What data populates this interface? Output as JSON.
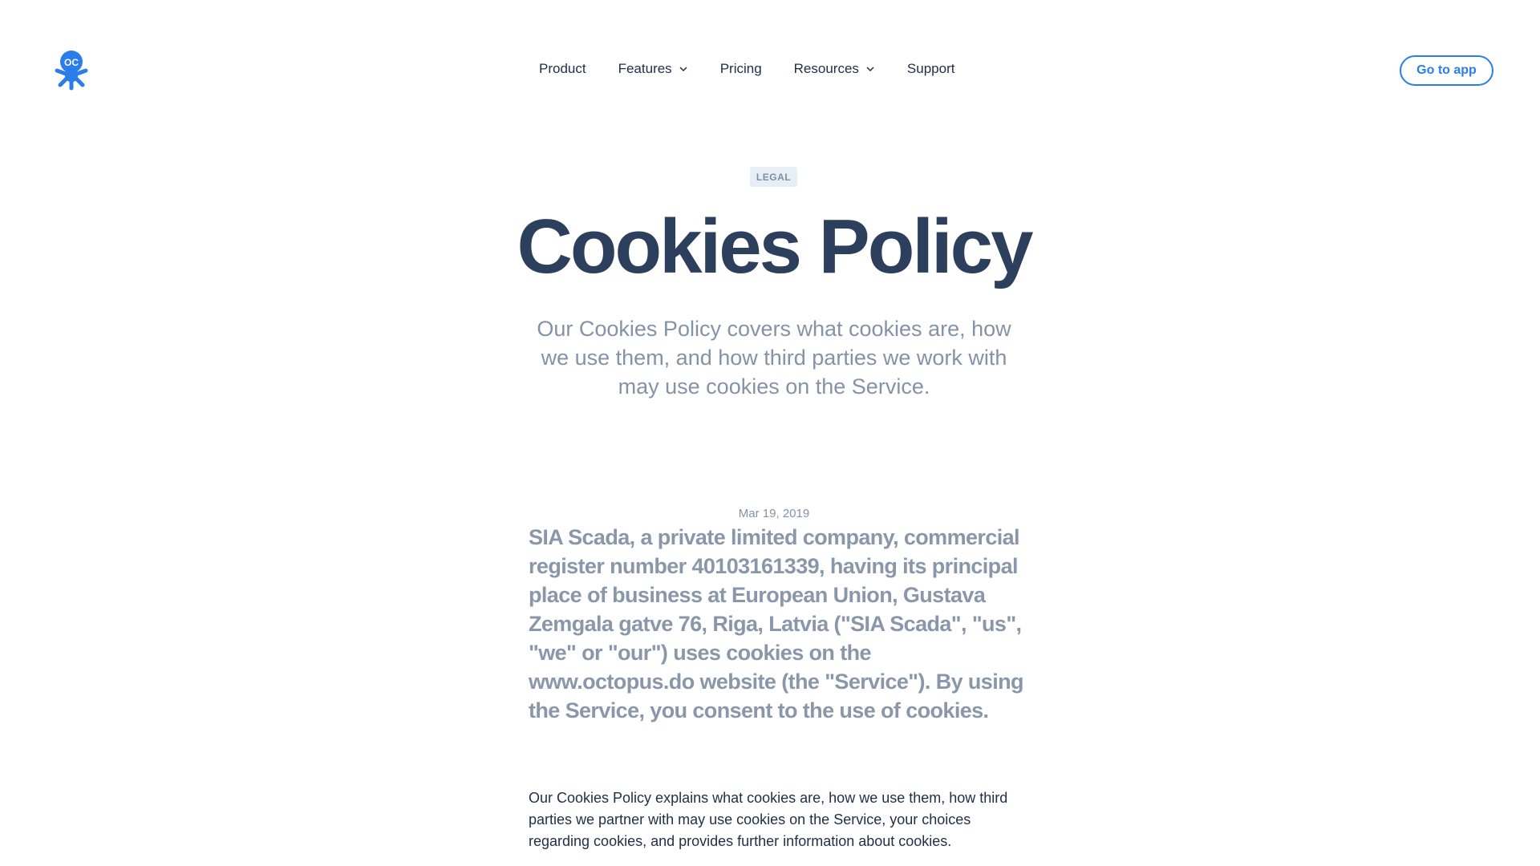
{
  "header": {
    "logo_icon": "octopus-logo-icon",
    "logo_text": "OC",
    "nav": [
      {
        "label": "Product",
        "has_dropdown": false
      },
      {
        "label": "Features",
        "has_dropdown": true
      },
      {
        "label": "Pricing",
        "has_dropdown": false
      },
      {
        "label": "Resources",
        "has_dropdown": true
      },
      {
        "label": "Support",
        "has_dropdown": false
      }
    ],
    "cta_label": "Go to app"
  },
  "hero": {
    "tag": "LEGAL",
    "title": "Cookies Policy",
    "subtitle": "Our Cookies Policy covers what cookies are, how we use them, and how third parties we work with may use cookies on the Service."
  },
  "content": {
    "date": "Mar 19, 2019",
    "lead": "SIA Scada, a private limited company, commercial register number 40103161339, having its principal place of business at European Union, Gustava Zemgala gatve 76, Riga, Latvia (\"SIA Scada\", \"us\", \"we\" or \"our\") uses cookies on the www.octopus.do website (the \"Service\"). By using the Service, you consent to the use of cookies.",
    "paragraph": "Our Cookies Policy explains what cookies are, how we use them, how third parties we partner with may use cookies on the Service, your choices regarding cookies, and provides further information about cookies."
  },
  "colors": {
    "accent": "#2b7de9",
    "title": "#2c3f5c",
    "muted": "#8493a8"
  }
}
